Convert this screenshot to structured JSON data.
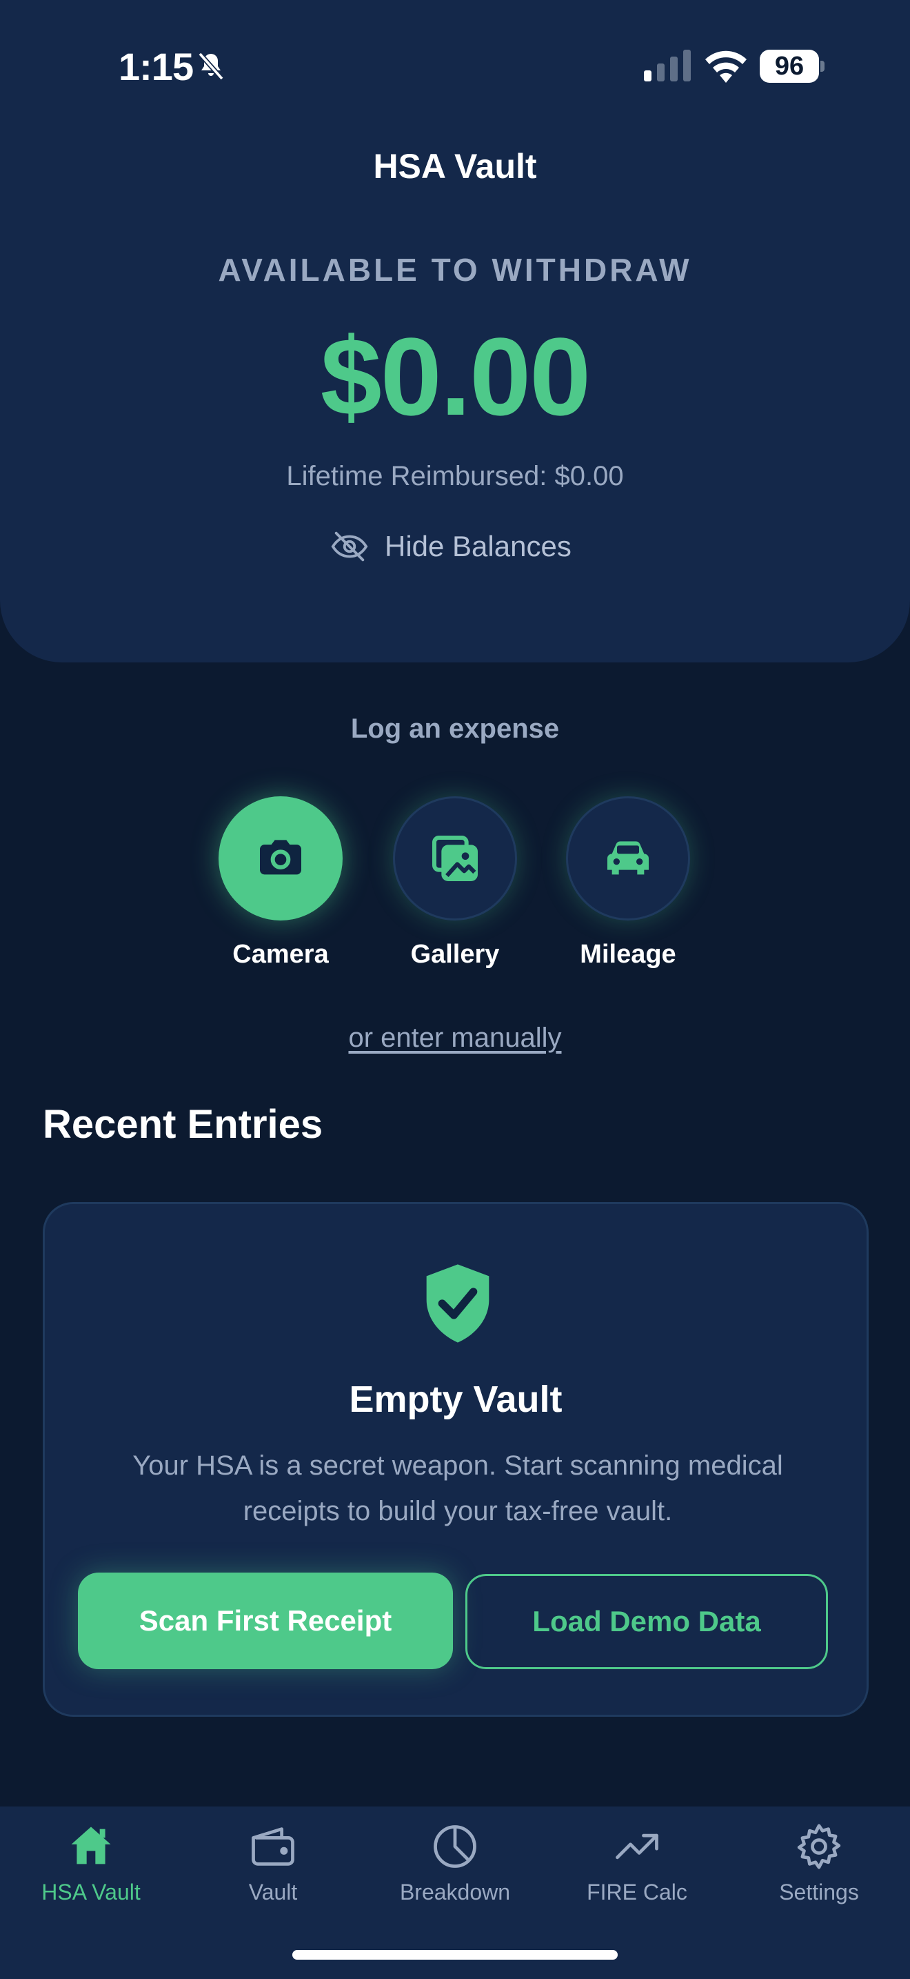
{
  "status_bar": {
    "time": "1:15",
    "battery": "96",
    "icons": [
      "bell-slash-icon",
      "signal-icon",
      "wifi-icon",
      "battery-icon"
    ]
  },
  "header": {
    "title": "HSA Vault",
    "available_label": "AVAILABLE TO WITHDRAW",
    "balance": "$0.00",
    "lifetime": "Lifetime Reimbursed: $0.00",
    "hide_label": "Hide Balances"
  },
  "log_expense": {
    "title": "Log an expense",
    "actions": [
      {
        "label": "Camera",
        "icon": "camera-icon"
      },
      {
        "label": "Gallery",
        "icon": "gallery-icon"
      },
      {
        "label": "Mileage",
        "icon": "car-icon"
      }
    ],
    "manual_link": "or enter manually"
  },
  "recent": {
    "title": "Recent Entries",
    "empty": {
      "icon": "shield-check-icon",
      "title": "Empty Vault",
      "description": "Your HSA is a secret weapon. Start scanning medical receipts to build your tax-free vault.",
      "primary_button": "Scan First Receipt",
      "secondary_button": "Load Demo Data"
    }
  },
  "tab_bar": {
    "tabs": [
      {
        "label": "HSA Vault",
        "icon": "home-icon",
        "active": true
      },
      {
        "label": "Vault",
        "icon": "wallet-icon",
        "active": false
      },
      {
        "label": "Breakdown",
        "icon": "pie-chart-icon",
        "active": false
      },
      {
        "label": "FIRE Calc",
        "icon": "trend-up-icon",
        "active": false
      },
      {
        "label": "Settings",
        "icon": "gear-icon",
        "active": false
      }
    ]
  },
  "colors": {
    "background": "#0c1a30",
    "card": "#14284a",
    "accent": "#4ec98a",
    "muted_text": "#9aa9c2"
  }
}
